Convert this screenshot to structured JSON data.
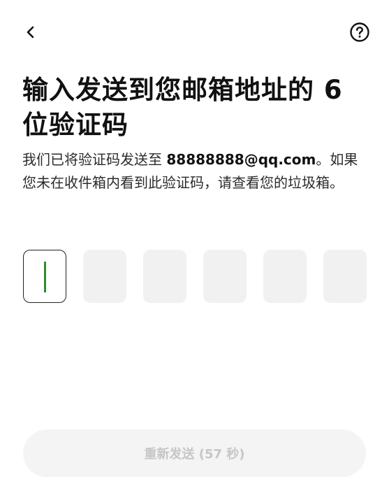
{
  "header": {
    "back_icon": "chevron-left-icon",
    "help_icon": "question-circle-icon"
  },
  "title": "输入发送到您邮箱地址的 6 位验证码",
  "description": {
    "prefix": "我们已将验证码发送至 ",
    "email": "88888888@qq.com",
    "suffix": "。如果您未在收件箱内看到此验证码，请查看您的垃圾箱。"
  },
  "code_input": {
    "length": 6,
    "active_index": 0,
    "digits": [
      "",
      "",
      "",
      "",
      "",
      ""
    ]
  },
  "resend_button": {
    "label": "重新发送 (57 秒)",
    "enabled": false
  },
  "colors": {
    "caret": "#2e8b2e",
    "box_background": "#f1f1f1",
    "disabled_text": "#c6c6c6"
  }
}
